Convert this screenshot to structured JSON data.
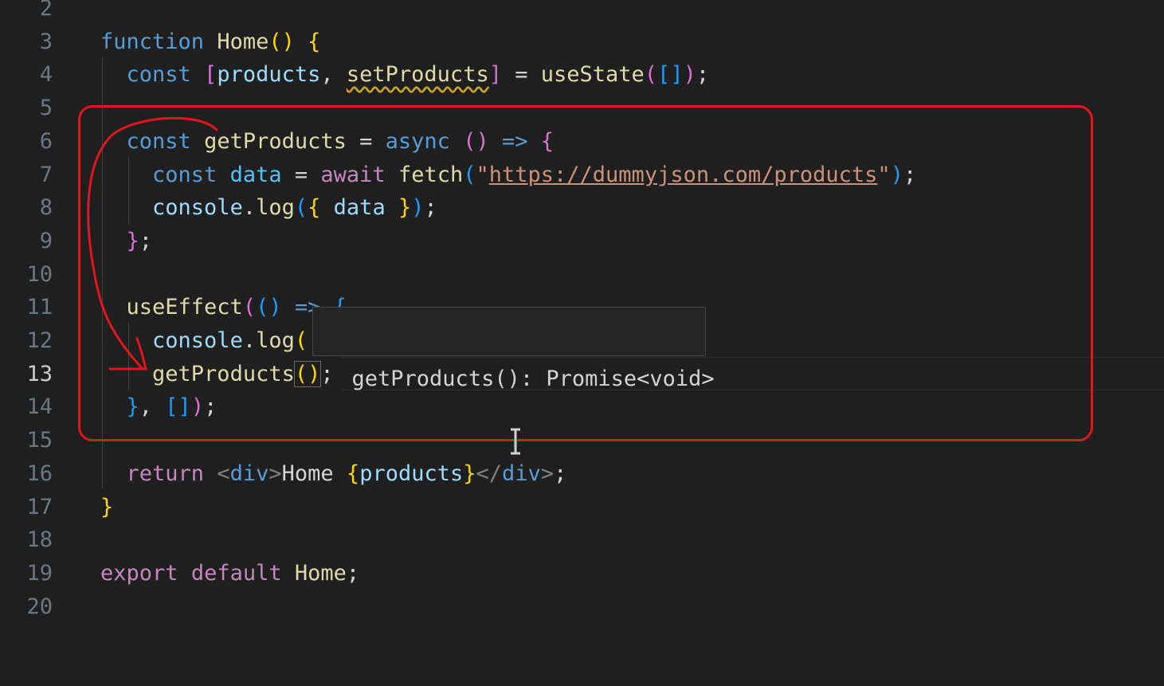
{
  "editor": {
    "active_line": "13",
    "lines": [
      {
        "num": "2",
        "tokens": []
      },
      {
        "num": "3",
        "tokens": [
          {
            "t": "function",
            "c": "kw"
          },
          {
            "t": " "
          },
          {
            "t": "Home",
            "c": "fn"
          },
          {
            "t": "()",
            "c": "b1"
          },
          {
            "t": " "
          },
          {
            "t": "{",
            "c": "b1"
          }
        ]
      },
      {
        "num": "4",
        "tokens": [
          {
            "t": "  "
          },
          {
            "t": "const",
            "c": "kw"
          },
          {
            "t": " "
          },
          {
            "t": "[",
            "c": "b2"
          },
          {
            "t": "products",
            "c": "var"
          },
          {
            "t": ", "
          },
          {
            "t": "setProducts",
            "c": "fn sq"
          },
          {
            "t": "]",
            "c": "b2"
          },
          {
            "t": " = "
          },
          {
            "t": "useState",
            "c": "fn"
          },
          {
            "t": "(",
            "c": "b2"
          },
          {
            "t": "[]",
            "c": "b3"
          },
          {
            "t": ")",
            "c": "b2"
          },
          {
            "t": ";"
          }
        ]
      },
      {
        "num": "5",
        "tokens": []
      },
      {
        "num": "6",
        "tokens": [
          {
            "t": "  "
          },
          {
            "t": "const",
            "c": "kw"
          },
          {
            "t": " "
          },
          {
            "t": "getProducts",
            "c": "fn"
          },
          {
            "t": " = "
          },
          {
            "t": "async",
            "c": "kw"
          },
          {
            "t": " "
          },
          {
            "t": "()",
            "c": "b2"
          },
          {
            "t": " "
          },
          {
            "t": "=>",
            "c": "kw"
          },
          {
            "t": " "
          },
          {
            "t": "{",
            "c": "b2"
          }
        ]
      },
      {
        "num": "7",
        "tokens": [
          {
            "t": "    "
          },
          {
            "t": "const",
            "c": "kw"
          },
          {
            "t": " "
          },
          {
            "t": "data",
            "c": "cst"
          },
          {
            "t": " = "
          },
          {
            "t": "await",
            "c": "kw2"
          },
          {
            "t": " "
          },
          {
            "t": "fetch",
            "c": "fn"
          },
          {
            "t": "(",
            "c": "b3"
          },
          {
            "t": "\"",
            "c": "str"
          },
          {
            "t": "https://dummyjson.com/products",
            "c": "url"
          },
          {
            "t": "\"",
            "c": "str"
          },
          {
            "t": ")",
            "c": "b3"
          },
          {
            "t": ";"
          }
        ]
      },
      {
        "num": "8",
        "tokens": [
          {
            "t": "    "
          },
          {
            "t": "console",
            "c": "var"
          },
          {
            "t": "."
          },
          {
            "t": "log",
            "c": "fn"
          },
          {
            "t": "(",
            "c": "b3"
          },
          {
            "t": "{",
            "c": "b1"
          },
          {
            "t": " "
          },
          {
            "t": "data",
            "c": "var"
          },
          {
            "t": " "
          },
          {
            "t": "}",
            "c": "b1"
          },
          {
            "t": ")",
            "c": "b3"
          },
          {
            "t": ";"
          }
        ]
      },
      {
        "num": "9",
        "tokens": [
          {
            "t": "  "
          },
          {
            "t": "}",
            "c": "b2"
          },
          {
            "t": ";"
          }
        ]
      },
      {
        "num": "10",
        "tokens": []
      },
      {
        "num": "11",
        "tokens": [
          {
            "t": "  "
          },
          {
            "t": "useEffect",
            "c": "fn"
          },
          {
            "t": "(",
            "c": "b2"
          },
          {
            "t": "()",
            "c": "b3"
          },
          {
            "t": " "
          },
          {
            "t": "=>",
            "c": "kw"
          },
          {
            "t": " "
          },
          {
            "t": "{",
            "c": "b3"
          }
        ]
      },
      {
        "num": "12",
        "tokens": [
          {
            "t": "    "
          },
          {
            "t": "console",
            "c": "var"
          },
          {
            "t": "."
          },
          {
            "t": "log",
            "c": "fn"
          },
          {
            "t": "(",
            "c": "b1"
          }
        ]
      },
      {
        "num": "13",
        "tokens": [
          {
            "t": "    "
          },
          {
            "t": "getProducts",
            "c": "fn"
          },
          {
            "t": "()",
            "c": "b1 hlbr"
          },
          {
            "t": ";"
          }
        ]
      },
      {
        "num": "14",
        "tokens": [
          {
            "t": "  "
          },
          {
            "t": "}",
            "c": "b3"
          },
          {
            "t": ", "
          },
          {
            "t": "[]",
            "c": "b3"
          },
          {
            "t": ")",
            "c": "b2"
          },
          {
            "t": ";"
          }
        ]
      },
      {
        "num": "15",
        "tokens": []
      },
      {
        "num": "16",
        "tokens": [
          {
            "t": "  "
          },
          {
            "t": "return",
            "c": "kw2"
          },
          {
            "t": " "
          },
          {
            "t": "<",
            "c": "tag"
          },
          {
            "t": "div",
            "c": "tagname"
          },
          {
            "t": ">",
            "c": "tag"
          },
          {
            "t": "Home "
          },
          {
            "t": "{",
            "c": "b1"
          },
          {
            "t": "products",
            "c": "var"
          },
          {
            "t": "}",
            "c": "b1"
          },
          {
            "t": "</",
            "c": "tag"
          },
          {
            "t": "div",
            "c": "tagname"
          },
          {
            "t": ">",
            "c": "tag"
          },
          {
            "t": ";"
          }
        ]
      },
      {
        "num": "17",
        "tokens": [
          {
            "t": "}",
            "c": "b1"
          }
        ]
      },
      {
        "num": "18",
        "tokens": []
      },
      {
        "num": "19",
        "tokens": [
          {
            "t": "export",
            "c": "kw2"
          },
          {
            "t": " "
          },
          {
            "t": "default",
            "c": "kw2"
          },
          {
            "t": " "
          },
          {
            "t": "Home",
            "c": "fn"
          },
          {
            "t": ";"
          }
        ]
      },
      {
        "num": "20",
        "tokens": []
      }
    ]
  },
  "hover_tooltip": {
    "signature": "getProducts(): Promise<void>"
  },
  "annotation": {
    "color": "#e0161c",
    "shape": "rounded-rectangle",
    "arrow": "curved arrow from getProducts declaration to getProducts() call"
  },
  "colors": {
    "background": "#1f1f1f",
    "keyword": "#569cd6",
    "control": "#c586c0",
    "function": "#dcdcaa",
    "variable": "#9cdcfe",
    "string": "#ce9178"
  }
}
